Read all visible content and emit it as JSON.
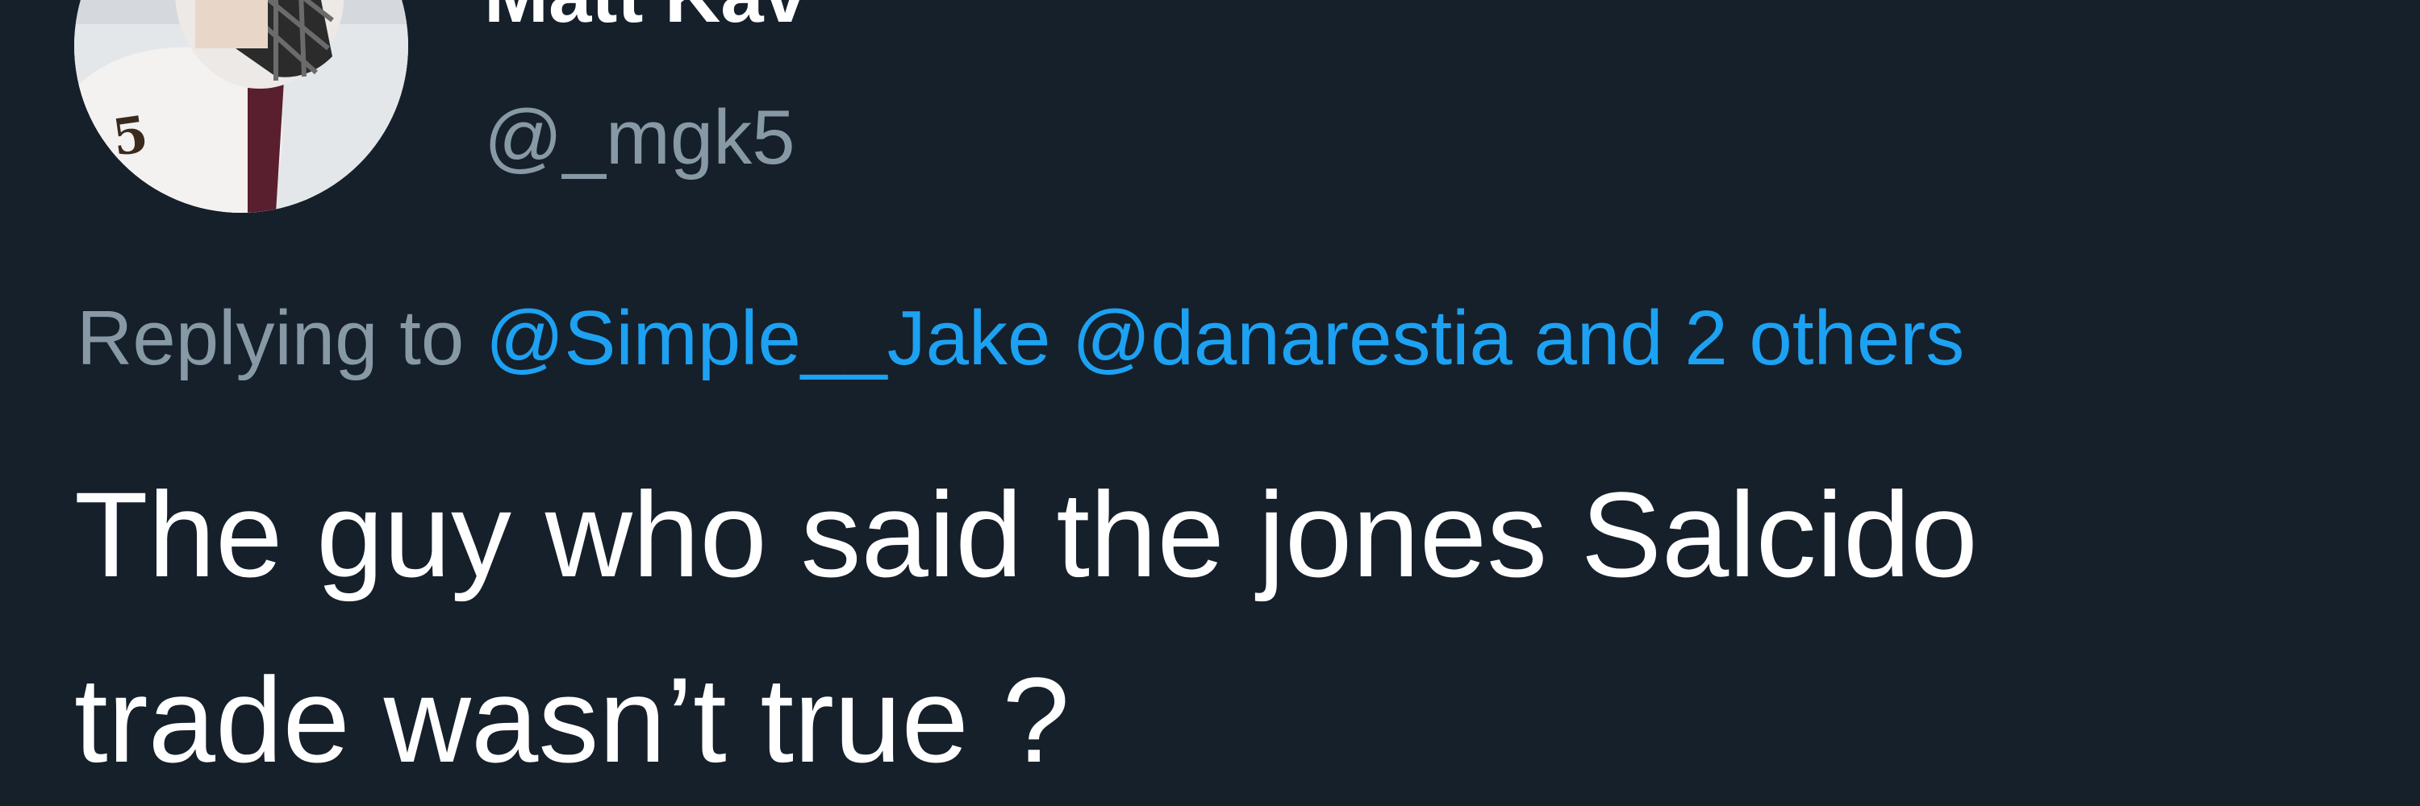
{
  "author": {
    "display_name": "Matt Kav",
    "handle": "@_mgk5",
    "avatar": "profile-photo-lacrosse-player"
  },
  "reply": {
    "prefix": "Replying to",
    "mentions": [
      "@Simple__Jake",
      "@danarestia"
    ],
    "others": "and 2 others"
  },
  "tweet": {
    "lines": [
      "The guy who said the jones Salcido",
      "trade wasn’t true ?"
    ]
  },
  "colors": {
    "background": "#15202b",
    "primary_text": "#ffffff",
    "secondary_text": "#8899a6",
    "link": "#1da1f2"
  }
}
